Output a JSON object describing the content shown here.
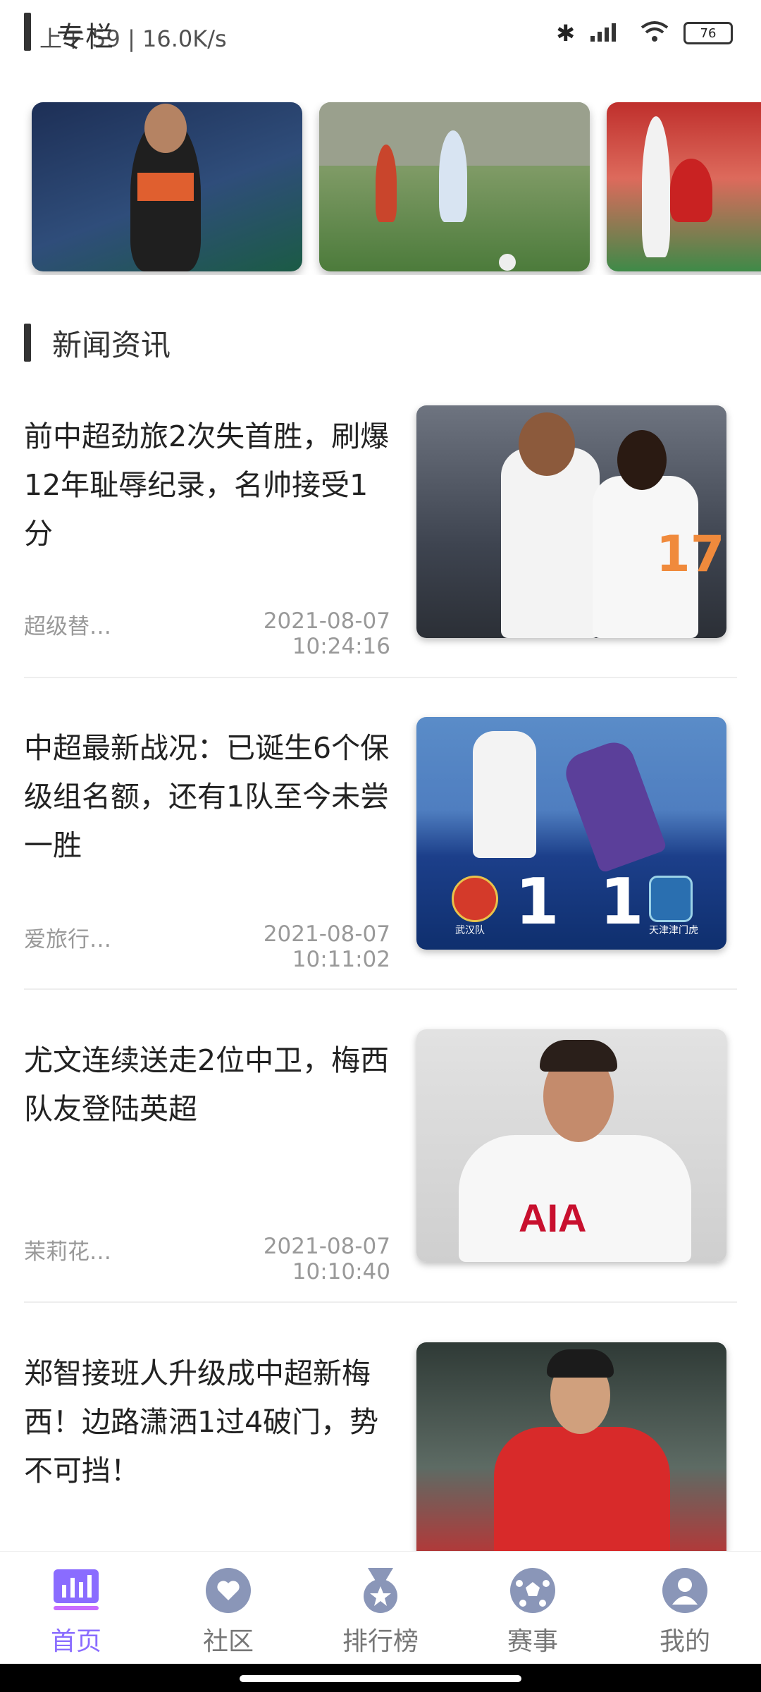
{
  "status_bar": {
    "overlay_title": "专栏",
    "time_and_speed": "上午 59 | 16.0K/s",
    "battery": "76"
  },
  "section": {
    "title": "新闻资讯"
  },
  "news": [
    {
      "title": "前中超劲旅2次失首胜，刷爆12年耻辱纪录，名帅接受1分",
      "source": "超级替…",
      "time": "2021-08-07 10:24:16"
    },
    {
      "title": "中超最新战况：已诞生6个保级组名额，还有1队至今未尝一胜",
      "source": "爱旅行…",
      "time": "2021-08-07 10:11:02",
      "image_text": {
        "score_left": "1",
        "score_right": "1",
        "team_left": "武汉队",
        "team_right": "天津津门虎"
      }
    },
    {
      "title": "尤文连续送走2位中卫，梅西队友登陆英超",
      "source": "茉莉花…",
      "time": "2021-08-07 10:10:40",
      "image_text": {
        "shirt_sponsor": "AIA"
      }
    },
    {
      "title": "郑智接班人升级成中超新梅西！边路潇洒1过4破门，势不可挡！"
    }
  ],
  "bottom_nav": [
    {
      "label": "首页",
      "icon": "chart-icon"
    },
    {
      "label": "社区",
      "icon": "heart-chat-icon"
    },
    {
      "label": "排行榜",
      "icon": "medal-icon"
    },
    {
      "label": "赛事",
      "icon": "soccer-ball-icon"
    },
    {
      "label": "我的",
      "icon": "user-icon"
    }
  ],
  "colors": {
    "accent": "#8a6cff",
    "nav_inactive": "#8a96b8"
  }
}
